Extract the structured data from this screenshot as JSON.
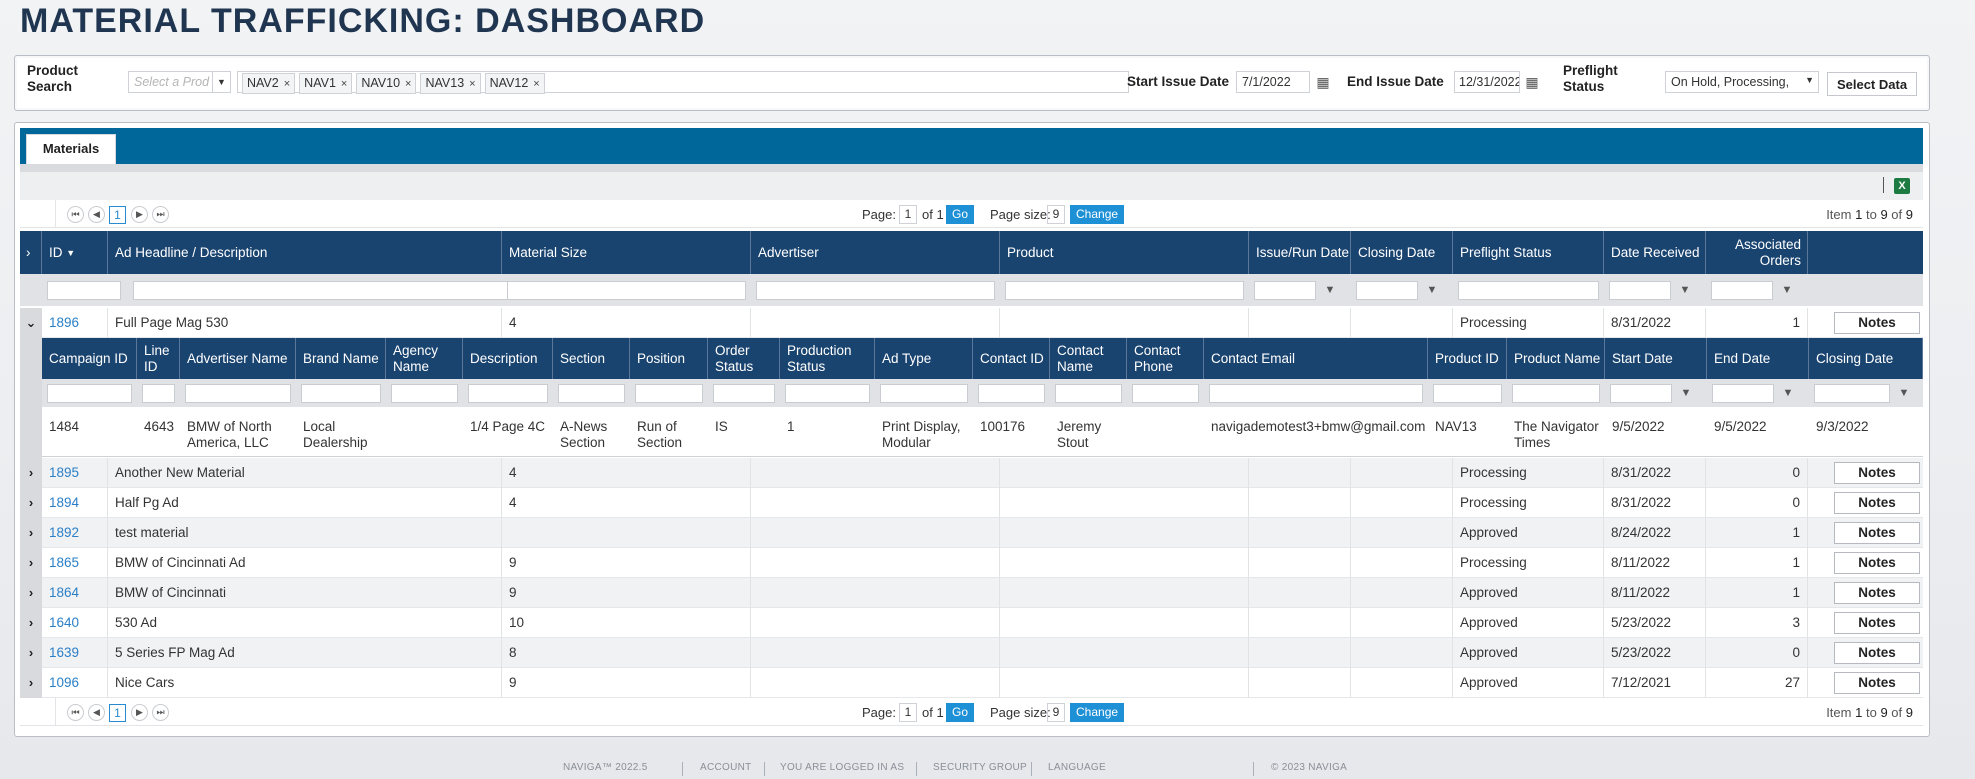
{
  "page_title": "MATERIAL TRAFFICKING: DASHBOARD",
  "filters": {
    "product_search_label": "Product Search",
    "product_placeholder": "Select a Prod",
    "chips": [
      "NAV2",
      "NAV1",
      "NAV10",
      "NAV13",
      "NAV12"
    ],
    "start_issue_label": "Start Issue Date",
    "start_issue_value": "7/1/2022",
    "end_issue_label": "End Issue Date",
    "end_issue_value": "12/31/2022",
    "preflight_label": "Preflight Status",
    "preflight_value": "On Hold, Processing,",
    "select_button": "Select Data"
  },
  "tabs": [
    "Materials"
  ],
  "pager": {
    "page_label": "Page:",
    "page_value": "1",
    "of_text": "of 1",
    "go": "Go",
    "size_label": "Page size:",
    "size_value": "9",
    "change": "Change",
    "current_page": "1",
    "item_prefix": "Item",
    "item_from": "1",
    "item_to_text": "to",
    "item_to": "9",
    "item_of_text": "of",
    "item_total": "9"
  },
  "columns": [
    "ID",
    "Ad Headline / Description",
    "Material Size",
    "Advertiser",
    "Product",
    "Issue/Run Date",
    "Closing Date",
    "Preflight Status",
    "Date Received",
    "Associated Orders"
  ],
  "notes_label": "Notes",
  "rows": [
    {
      "id": "1896",
      "headline": "Full Page Mag 530",
      "size": "4",
      "status": "Processing",
      "received": "8/31/2022",
      "orders": "1"
    },
    {
      "id": "1895",
      "headline": "Another New Material",
      "size": "4",
      "status": "Processing",
      "received": "8/31/2022",
      "orders": "0"
    },
    {
      "id": "1894",
      "headline": "Half Pg Ad",
      "size": "4",
      "status": "Processing",
      "received": "8/31/2022",
      "orders": "0"
    },
    {
      "id": "1892",
      "headline": "test material",
      "size": "",
      "status": "Approved",
      "received": "8/24/2022",
      "orders": "1"
    },
    {
      "id": "1865",
      "headline": "BMW of Cincinnati Ad",
      "size": "9",
      "status": "Processing",
      "received": "8/11/2022",
      "orders": "1"
    },
    {
      "id": "1864",
      "headline": "BMW of Cincinnati",
      "size": "9",
      "status": "Approved",
      "received": "8/11/2022",
      "orders": "1"
    },
    {
      "id": "1640",
      "headline": "530 Ad",
      "size": "10",
      "status": "Approved",
      "received": "5/23/2022",
      "orders": "3"
    },
    {
      "id": "1639",
      "headline": "5 Series FP Mag Ad",
      "size": "8",
      "status": "Approved",
      "received": "5/23/2022",
      "orders": "0"
    },
    {
      "id": "1096",
      "headline": "Nice Cars",
      "size": "9",
      "status": "Approved",
      "received": "7/12/2021",
      "orders": "27"
    }
  ],
  "detail": {
    "columns": [
      "Campaign ID",
      "Line ID",
      "Advertiser Name",
      "Brand Name",
      "Agency Name",
      "Description",
      "Section",
      "Position",
      "Order Status",
      "Production Status",
      "Ad Type",
      "Contact ID",
      "Contact Name",
      "Contact Phone",
      "Contact Email",
      "Product ID",
      "Product Name",
      "Start Date",
      "End Date",
      "Closing Date"
    ],
    "row": {
      "campaign_id": "1484",
      "line_id": "4643",
      "advertiser_name": "BMW of North America, LLC",
      "brand_name": "Local Dealership",
      "agency_name": "",
      "description": "1/4 Page 4C",
      "section": "A-News Section",
      "position": "Run of Section",
      "order_status": "IS",
      "production_status": "1",
      "ad_type": "Print Display, Modular",
      "contact_id": "100176",
      "contact_name": "Jeremy Stout",
      "contact_phone": "",
      "contact_email": "navigademotest3+bmw@gmail.com",
      "product_id": "NAV13",
      "product_name": "The Navigator Times",
      "start_date": "9/5/2022",
      "end_date": "9/5/2022",
      "closing_date": "9/3/2022"
    }
  },
  "footer": {
    "version": "NAVIGA™ 2022.5",
    "account": "ACCOUNT",
    "logged": "YOU ARE LOGGED IN AS",
    "security": "SECURITY GROUP",
    "language": "LANGUAGE",
    "copyright": "© 2023 NAVIGA"
  }
}
